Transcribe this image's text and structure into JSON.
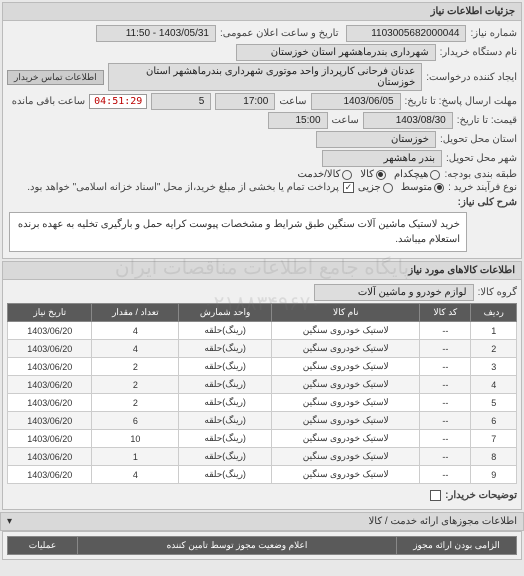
{
  "panel1": {
    "title": "جزئیات اطلاعات نیاز",
    "req_no_label": "شماره نیاز:",
    "req_no": "1103005682000044",
    "ann_label": "تاریخ و ساعت اعلان عمومی:",
    "ann_value": "1403/05/31 - 11:50",
    "buyer_label": "نام دستگاه خریدار:",
    "buyer": "شهرداری بندرماهشهر استان خوزستان",
    "requester_label": "ایجاد کننده درخواست:",
    "requester": "عدنان فرحانی کارپرداز واحد موتوری شهرداری بندرماهشهر استان خوزستان",
    "contact_btn": "اطلاعات تماس خریدار",
    "deadline_label": "مهلت ارسال پاسخ: تا تاریخ:",
    "deadline_date": "1403/06/05",
    "time_label": "ساعت",
    "deadline_time": "17:00",
    "ext_days": "5",
    "remain_label": "ساعت باقی مانده",
    "remain_timer": "04:51:29",
    "quote_label": "قیمت: تا تاریخ:",
    "quote_date": "1403/08/30",
    "quote_time": "15:00",
    "province_label": "استان محل تحویل:",
    "province": "خوزستان",
    "city_label": "شهر محل تحویل:",
    "city": "بندر ماهشهر",
    "budget_label": "طبقه بندی بودجه:",
    "budget_opts": [
      "هیچکدام",
      "کالا",
      "کالا/خدمت"
    ],
    "budget_sel": 1,
    "buy_type_label": "نوع فرآیند خرید :",
    "buy_opts": [
      "متوسط",
      "جزیی"
    ],
    "buy_sel": 0,
    "note": "پرداخت تمام یا بخشی از مبلغ خرید،از محل \"اسناد خزانه اسلامی\" خواهد بود.",
    "note_checked": true,
    "summary_label": "شرح کلی نیاز:",
    "summary": "خرید لاستیک ماشین آلات سنگین طبق شرایط و مشخصات پیوست کرایه حمل و بارگیری تخلیه به عهده برنده استعلام میباشد."
  },
  "goods": {
    "title": "اطلاعات کالاهای مورد نیاز",
    "group_label": "گروه کالا:",
    "group": "لوازم خودرو و ماشین آلات",
    "headers": [
      "ردیف",
      "کد کالا",
      "نام کالا",
      "واحد شمارش",
      "تعداد / مقدار",
      "تاریخ نیاز"
    ],
    "rows": [
      {
        "n": "1",
        "code": "--",
        "name": "لاستیک خودروی سنگین",
        "unit": "(رینگ)حلقه",
        "qty": "4",
        "date": "1403/06/20"
      },
      {
        "n": "2",
        "code": "--",
        "name": "لاستیک خودروی سنگین",
        "unit": "(رینگ)حلقه",
        "qty": "4",
        "date": "1403/06/20"
      },
      {
        "n": "3",
        "code": "--",
        "name": "لاستیک خودروی سنگین",
        "unit": "(رینگ)حلقه",
        "qty": "2",
        "date": "1403/06/20"
      },
      {
        "n": "4",
        "code": "--",
        "name": "لاستیک خودروی سنگین",
        "unit": "(رینگ)حلقه",
        "qty": "2",
        "date": "1403/06/20"
      },
      {
        "n": "5",
        "code": "--",
        "name": "لاستیک خودروی سنگین",
        "unit": "(رینگ)حلقه",
        "qty": "2",
        "date": "1403/06/20"
      },
      {
        "n": "6",
        "code": "--",
        "name": "لاستیک خودروی سنگین",
        "unit": "(رینگ)حلقه",
        "qty": "6",
        "date": "1403/06/20"
      },
      {
        "n": "7",
        "code": "--",
        "name": "لاستیک خودروی سنگین",
        "unit": "(رینگ)حلقه",
        "qty": "10",
        "date": "1403/06/20"
      },
      {
        "n": "8",
        "code": "--",
        "name": "لاستیک خودروی سنگین",
        "unit": "(رینگ)حلقه",
        "qty": "1",
        "date": "1403/06/20"
      },
      {
        "n": "9",
        "code": "--",
        "name": "لاستیک خودروی سنگین",
        "unit": "(رینگ)حلقه",
        "qty": "4",
        "date": "1403/06/20"
      }
    ],
    "buyer_note_label": "توضیحات خریدار:"
  },
  "permits": {
    "title": "اطلاعات مجوزهای ارائه خدمت / کالا",
    "col_required": "الزامی بودن ارائه مجوز",
    "col_announce": "اعلام وضعیت مجوز توسط تامین کننده",
    "col_ops": "عملیات"
  },
  "watermark_l1": "پایگاه جامع اطلاعات مناقصات ایران",
  "watermark_l2": "۰۲۱۸۸۳۴۹۶۷۰"
}
